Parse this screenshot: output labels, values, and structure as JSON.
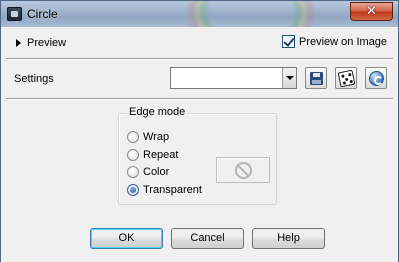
{
  "window": {
    "title": "Circle",
    "close_glyph": "✕"
  },
  "preview": {
    "toggle_label": "Preview",
    "on_image_label": "Preview on Image",
    "on_image_checked": true
  },
  "settings": {
    "label": "Settings",
    "combo_value": "",
    "icons": [
      "save-preset-icon",
      "randomize-dice-icon",
      "reset-icon"
    ]
  },
  "edge_mode": {
    "title": "Edge mode",
    "options": [
      "Wrap",
      "Repeat",
      "Color",
      "Transparent"
    ],
    "selected": "Transparent",
    "color_swatch_icon": "no-color-icon"
  },
  "buttons": {
    "ok": "OK",
    "cancel": "Cancel",
    "help": "Help"
  },
  "colors": {
    "titlebar": "#9fb3cc",
    "client_bg": "#f0f0f0",
    "close_red": "#c0391b",
    "default_button_border": "#3c7fb1"
  }
}
